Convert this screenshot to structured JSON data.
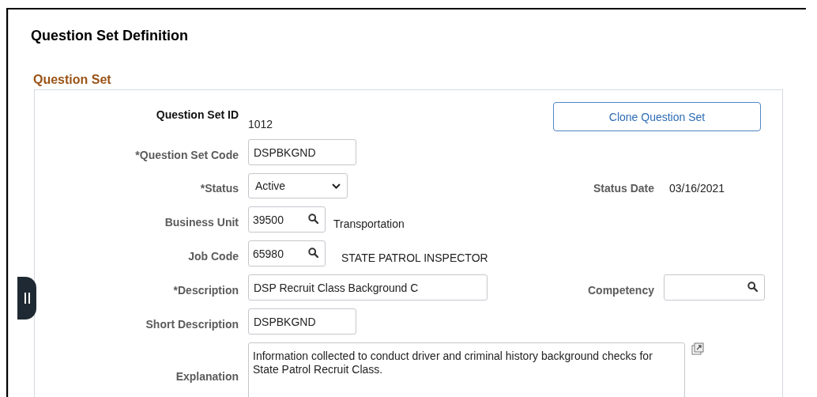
{
  "page": {
    "title": "Question Set Definition"
  },
  "section": {
    "title": "Question Set"
  },
  "rows": [
    {
      "kind": "display",
      "label": "Question Set ID",
      "value": "1012",
      "aside": {
        "kind": "button",
        "label": "Clone Question Set"
      }
    },
    {
      "kind": "text",
      "label": "*Question Set Code",
      "value": "DSPBKGND"
    },
    {
      "kind": "select",
      "label": "*Status",
      "value": "Active",
      "aside": {
        "kind": "display",
        "label": "Status Date",
        "value": "03/16/2021"
      }
    },
    {
      "kind": "lookup",
      "label": "Business Unit",
      "value": "39500",
      "description": "Transportation"
    },
    {
      "kind": "lookup",
      "label": "Job Code",
      "value": "65980",
      "description": "STATE PATROL INSPECTOR"
    },
    {
      "kind": "text",
      "label": "*Description",
      "value": "DSP Recruit Class Background C",
      "aside": {
        "kind": "lookup",
        "label": "Competency"
      }
    },
    {
      "kind": "text",
      "label": "Short Description",
      "value": "DSPBKGND"
    },
    {
      "kind": "textarea",
      "label": "Explanation",
      "value": "Information collected to conduct driver and criminal history background checks for State Patrol Recruit Class."
    }
  ]
}
